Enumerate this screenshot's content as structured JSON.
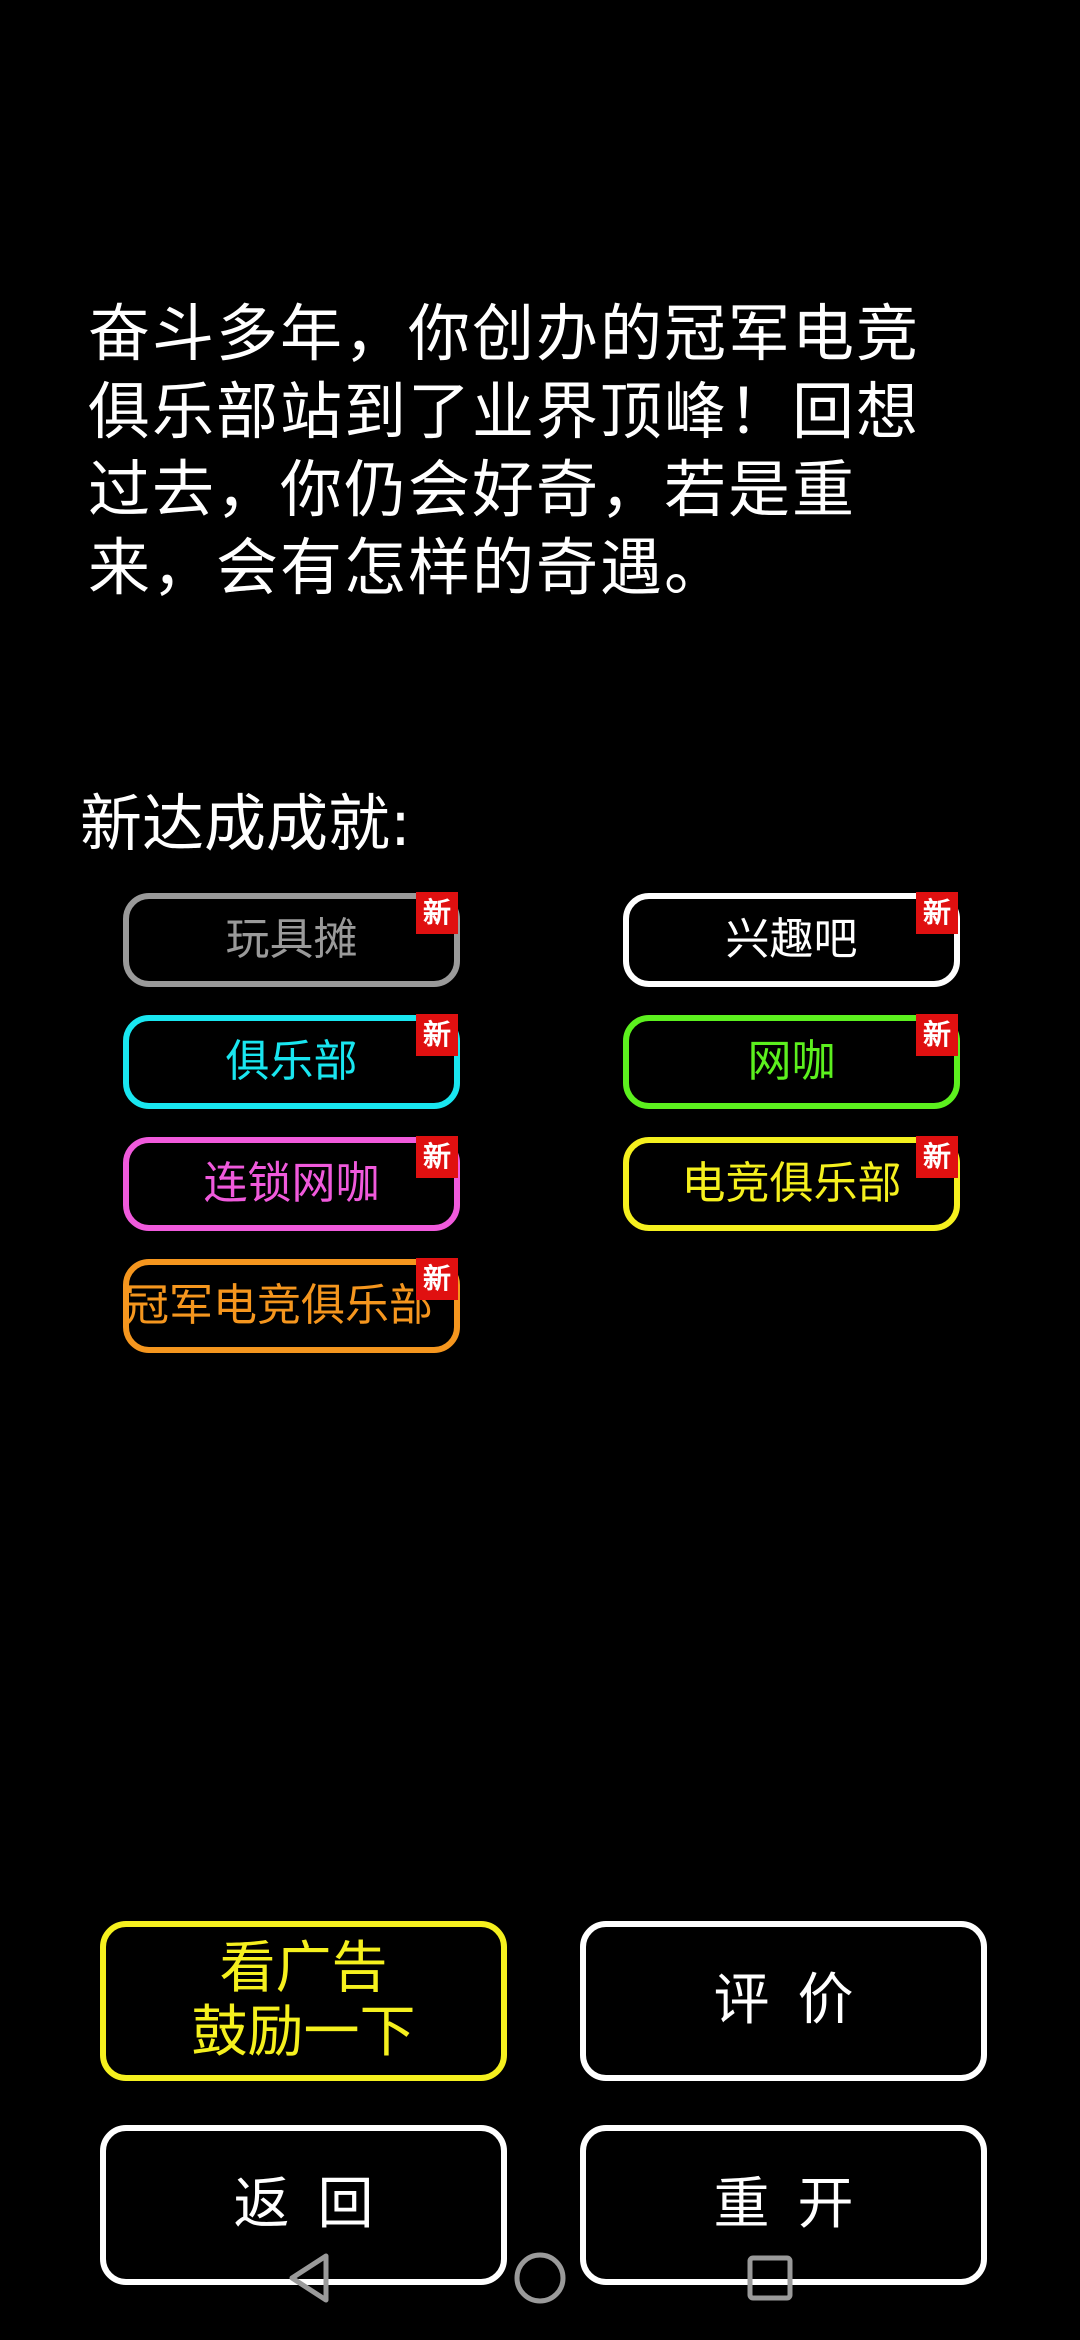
{
  "story": {
    "lines": [
      "奋斗多年，你创办的冠军电竞",
      "俱乐部站到了业界顶峰！回想",
      "过去，你仍会好奇，若是重",
      "来，会有怎样的奇遇。"
    ]
  },
  "achievements": {
    "title": "新达成成就:",
    "new_tag": "新",
    "items": [
      {
        "label": "玩具摊",
        "color": "#9a9a9a"
      },
      {
        "label": "兴趣吧",
        "color": "#ffffff"
      },
      {
        "label": "俱乐部",
        "color": "#19e6f0"
      },
      {
        "label": "网咖",
        "color": "#5cf01e"
      },
      {
        "label": "连锁网咖",
        "color": "#f05adc"
      },
      {
        "label": "电竞俱乐部",
        "color": "#f5f01e"
      },
      {
        "label": "冠军电竞俱乐部",
        "color": "#f5961e"
      }
    ]
  },
  "buttons": {
    "watch_ad": {
      "line1": "看广告",
      "line2": "鼓励一下",
      "color": "#f5f01e"
    },
    "rate": {
      "label": "评价",
      "color": "#ffffff"
    },
    "back": {
      "label": "返回",
      "color": "#ffffff"
    },
    "restart": {
      "label": "重开",
      "color": "#ffffff"
    }
  },
  "navbar": {
    "icons": [
      "back-triangle-icon",
      "home-circle-icon",
      "recents-square-icon"
    ],
    "color": "#9a9a9a"
  }
}
